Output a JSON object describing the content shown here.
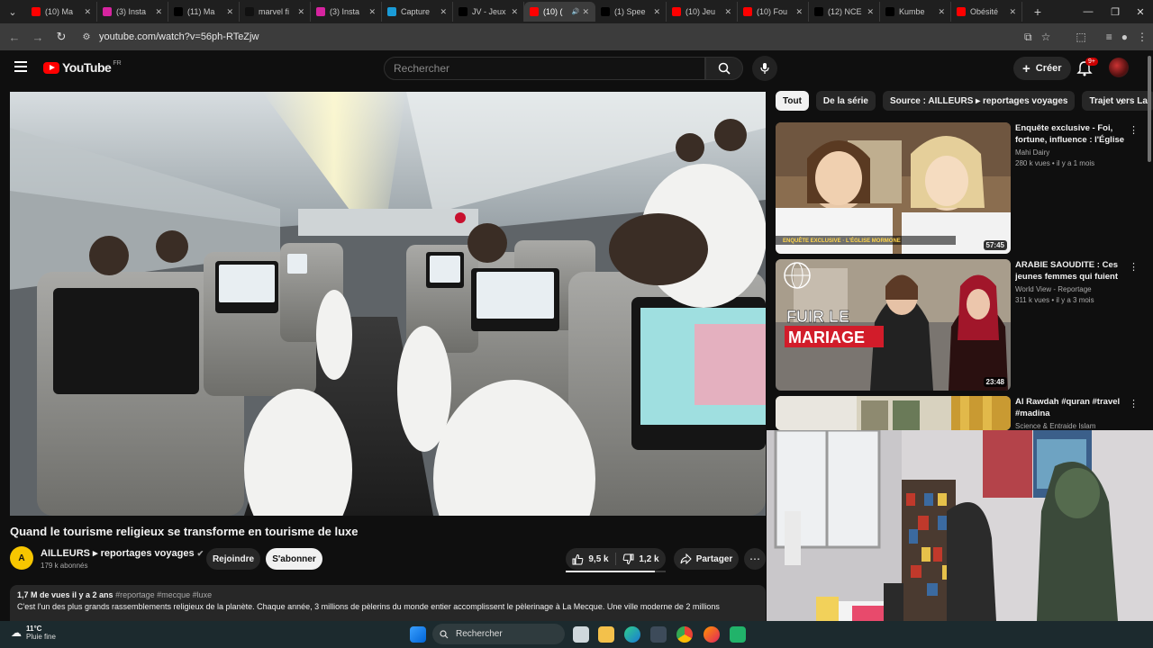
{
  "browser": {
    "tabs": [
      {
        "label": "(10) Ma",
        "fav_color": "#ff0000",
        "active": false
      },
      {
        "label": "(3) Insta",
        "fav_color": "#d6249f",
        "active": false
      },
      {
        "label": "(11) Ma",
        "fav_color": "#000000",
        "active": false
      },
      {
        "label": "marvel fi",
        "fav_color": "#111111",
        "active": false
      },
      {
        "label": "(3) Insta",
        "fav_color": "#d6249f",
        "active": false
      },
      {
        "label": "Capture",
        "fav_color": "#1a9bd7",
        "active": false
      },
      {
        "label": "JV - Jeux",
        "fav_color": "#000000",
        "active": false
      },
      {
        "label": "(10) (",
        "fav_color": "#ff0000",
        "active": true
      },
      {
        "label": "(1) Spee",
        "fav_color": "#000000",
        "active": false
      },
      {
        "label": "(10) Jeu",
        "fav_color": "#ff0000",
        "active": false
      },
      {
        "label": "(10) Fou",
        "fav_color": "#ff0000",
        "active": false
      },
      {
        "label": "(12) NCE",
        "fav_color": "#000000",
        "active": false
      },
      {
        "label": "Kumbe",
        "fav_color": "#000000",
        "active": false
      },
      {
        "label": "Obésité",
        "fav_color": "#ff0000",
        "active": false
      }
    ],
    "url": "youtube.com/watch?v=56ph-RTeZjw"
  },
  "header": {
    "logo_text": "YouTube",
    "logo_country": "FR",
    "search_placeholder": "Rechercher",
    "create_label": "Créer",
    "notif_badge": "9+"
  },
  "video": {
    "title": "Quand le tourisme religieux se transforme en tourisme de luxe",
    "channel_initial": "A",
    "channel_name": "AILLEURS ▸ reportages voyages",
    "subscribers": "179 k abonnés",
    "join_label": "Rejoindre",
    "subscribe_label": "S'abonner",
    "likes": "9,5 k",
    "dislikes": "1,2 k",
    "like_ratio": 0.89,
    "share_label": "Partager",
    "views_date": "1,7 M de vues  il y a 2 ans",
    "tags": "#reportage #mecque #luxe",
    "description": "C'est l'un des plus grands rassemblements religieux de la planète. Chaque année, 3 millions de pèlerins du monde entier accomplissent le pèlerinage à La Mecque. Une ville moderne de 2 millions"
  },
  "chips": [
    "Tout",
    "De la série",
    "Source : AILLEURS ▸ reportages voyages",
    "Trajet vers La"
  ],
  "recommendations": [
    {
      "title": "Enquête exclusive - Foi, fortune, influence : l'Église ...",
      "channel": "Mahi Dairy",
      "stats": "280 k vues • il y a 1 mois",
      "duration": "57:45"
    },
    {
      "title": "ARABIE SAOUDITE : Ces jeunes femmes qui fuient ...",
      "channel": "World View - Reportage",
      "stats": "311 k vues • il y a 3 mois",
      "duration": "23:48",
      "overlay_line1": "FUIR LE",
      "overlay_line2": "MARIAGE"
    },
    {
      "title": "Al Rawdah #quran #travel #madina",
      "channel": "Science & Entraide Islam",
      "stats": "",
      "duration": ""
    }
  ],
  "taskbar": {
    "temp": "11°C",
    "weather": "Pluie fine",
    "search_label": "Rechercher"
  },
  "thumb1_caption": "ENQUÊTE EXCLUSIVE · L'ÉGLISE MORMONE"
}
